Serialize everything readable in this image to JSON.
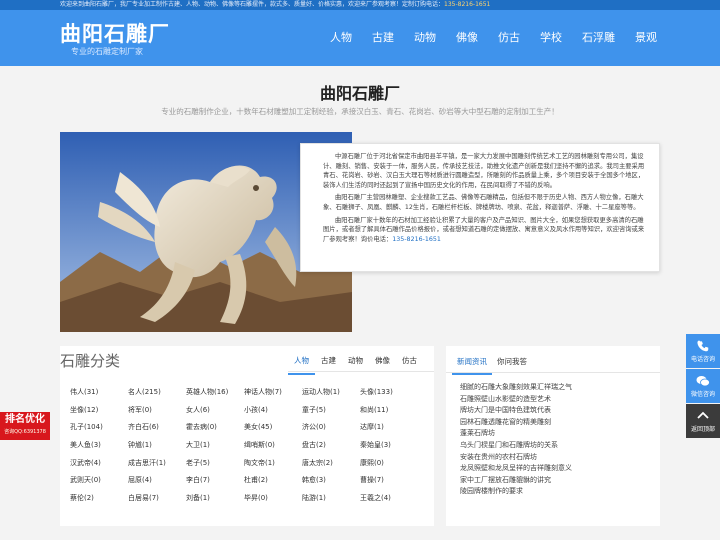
{
  "topbar": {
    "text": "欢迎来到曲阳石雕厂，我厂专业加工制作古建、人物、动物、佛像等石雕摆件，款式多、质量好、价格实惠，欢迎来厂参观考察！定制订购电话：",
    "phone": "135-8216-1651"
  },
  "header": {
    "logo": "曲阳石雕厂",
    "slogan": "专业的石雕定制厂家",
    "nav": [
      "人物",
      "古建",
      "动物",
      "佛像",
      "仿古",
      "学校",
      "石浮雕",
      "景观"
    ]
  },
  "hero": {
    "title": "曲阳石雕厂",
    "subtitle": "专业的石雕制作企业，十数年石材雕塑加工定制经验，承接汉白玉、青石、花岗岩、砂岩等大中型石雕的定制加工生产！"
  },
  "intro": {
    "p1": "中源石雕厂位于河北省保定市曲阳县羊平镇，是一家大力发展中国雕刻传统艺术工艺的园林雕刻专用公司，集设计、雕刻、销售、安装于一体，服务人民，传承技艺技法，助推文化遗产创新是我们坚持不懈的追求。我司主要采用青石、花岗岩、砂岩、汉白玉大理石等材质进行圆雕造型，所雕刻的作品质量上乘，多个项目安装于全国多个地区，装饰人们生活的同时还起到了宣扬中国历史文化的作用，在民间取得了不错的反响。",
    "p2": "曲阳石雕厂主营园林雕塑、企业搜款工艺品、佛像等石雕精品，包括但不限于历史人物、西方人物立像，石雕大象、石雕狮子、凤凰、麒麟、12生肖，石雕栏杆栏板、牌楼牌坊、喷泉、花盆，释迦普萨、浮雕、十二星座等等。",
    "p3": "曲阳石雕厂家十数年的石材加工经验让积累了大量的客户及产品知识、图片大全，如果您想获取更多高清的石雕图片，或者想了解具体石雕作品价格报价，或者想知道石雕的定做摆放、寓意意义及风水作用等知识，欢迎咨询或来厂参观考察！询价电话：",
    "phone": "135-8216-1651"
  },
  "categories": {
    "heading": "石雕分类",
    "tabs": [
      "人物",
      "古建",
      "动物",
      "佛像",
      "仿古"
    ],
    "active_tab": "人物",
    "items": [
      "伟人(31)",
      "名人(215)",
      "英雄人物(16)",
      "神话人物(7)",
      "运动人物(1)",
      "头像(133)",
      "坐像(12)",
      "将军(0)",
      "女人(6)",
      "小孩(4)",
      "童子(5)",
      "和尚(11)",
      "孔子(104)",
      "齐白石(6)",
      "霍去病(0)",
      "美女(45)",
      "济公(0)",
      "达摩(1)",
      "美人鱼(3)",
      "钟馗(1)",
      "大卫(1)",
      "缉哨斯(0)",
      "盘古(2)",
      "秦始皇(3)",
      "汉武帝(4)",
      "成吉思汗(1)",
      "老子(5)",
      "陶文帝(1)",
      "唐太宗(2)",
      "康熙(0)",
      "武则天(0)",
      "屈原(4)",
      "李白(7)",
      "杜甫(2)",
      "韩愈(3)",
      "曹操(7)",
      "蔡伦(2)",
      "白居易(7)",
      "刘备(1)",
      "毕昇(0)",
      "陆游(1)",
      "王羲之(4)"
    ]
  },
  "news": {
    "tabs": [
      "新闻资讯",
      "你问我答"
    ],
    "active_tab": "新闻资讯",
    "items": [
      "细腻的石雕大象雕刻效果汇祥瑞之气",
      "石雕照壁山水影壁的造型艺术",
      "牌坊大门是中国特色建筑代表",
      "园林石雕透雕花窗的精美雕刻",
      "蓬莱石牌坊",
      "乌头门棂星门和石雕牌坊的关系",
      "安装在贵州的农村石牌坊",
      "龙凤照壁和龙凤呈祥的吉祥雕刻意义",
      "家中工厂摆放石雕貔貅的讲究",
      "陵园牌楼制作的要求"
    ]
  },
  "badge": {
    "title": "排名优化",
    "qq": "咨询QQ:6391378"
  },
  "sidebar": [
    {
      "label": "电话咨询",
      "icon": "phone-icon"
    },
    {
      "label": "微信咨询",
      "icon": "wechat-icon"
    },
    {
      "label": "返回顶部",
      "icon": "back-to-top-icon"
    }
  ],
  "colors": {
    "brand": "#3f93ec",
    "topbar": "#1f6fc4",
    "badge": "#d8171d"
  }
}
